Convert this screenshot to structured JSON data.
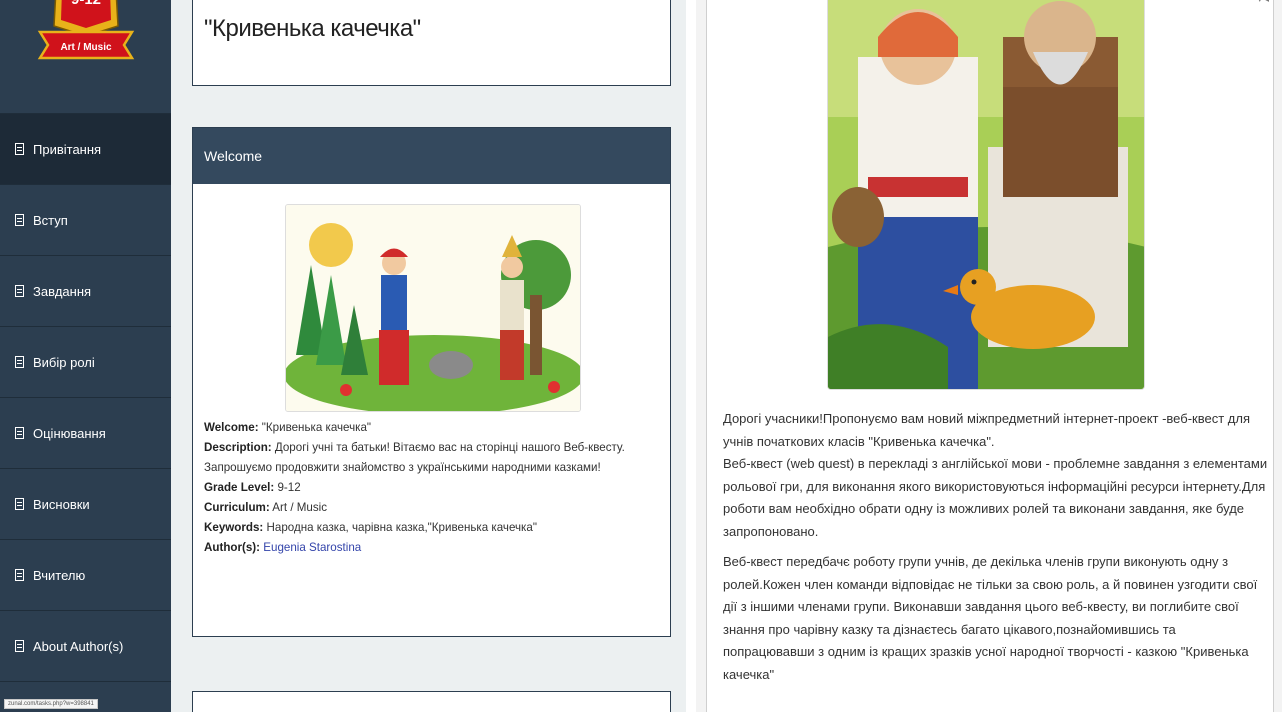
{
  "sidebar": {
    "badge": {
      "grade": "9-12",
      "subject": "Art / Music"
    },
    "items": [
      {
        "label": "Привітання",
        "active": true
      },
      {
        "label": "Вступ",
        "active": false
      },
      {
        "label": "Завдання",
        "active": false
      },
      {
        "label": "Вибір ролі",
        "active": false
      },
      {
        "label": "Оцінювання",
        "active": false
      },
      {
        "label": "Висновки",
        "active": false
      },
      {
        "label": "Вчителю",
        "active": false
      },
      {
        "label": "About Author(s)",
        "active": false
      }
    ]
  },
  "status_bar": {
    "url": "zunal.com/tasks.php?w=398841"
  },
  "page": {
    "title": "\"Кривенька качечка\""
  },
  "welcome_card": {
    "header": "Welcome",
    "welcome_label": "Welcome:",
    "welcome_value": " \"Кривенька качечка\"",
    "description_label": "Description:",
    "description_value": " Дорогі учні та батьки! Вітаємо вас на сторінці нашого Веб-квесту. Запрошуємо продовжити знайомство з українськими народними казками!",
    "grade_label": "Grade Level:",
    "grade_value": " 9-12",
    "curriculum_label": "Curriculum:",
    "curriculum_value": " Art / Music",
    "keywords_label": "Keywords:",
    "keywords_value": " Народна казка, чарівна казка,\"Кривенька качечка\"",
    "author_label": "Author(s):",
    "author_value": "Eugenia Starostina"
  },
  "right_pane": {
    "corner_text": "▾ ◂",
    "paragraph1": "Дорогі учасники!Пропонуємо вам новий міжпредметний інтернет-проект -веб-квест для учнів початкових класів \"Кривенька качечка\".",
    "paragraph2": "Веб-квест (web quest) в перекладі з англійської мови - проблемне завдання з елементами рольової гри, для виконання якого використовуються інформаційні ресурси інтернету.Для роботи вам необхідно обрати одну із можливих ролей та виконани  завдання, яке буде запропоновано.",
    "paragraph3": "Веб-квест передбачє роботу групи учнів, де декілька членів групи виконують одну з ролей.Кожен член команди відповідає не тільки за свою роль, а й повинен узгодити свої дії з іншими членами групи. Виконавши завдання цього веб-квесту, ви поглибите свої знання про чарівну казку та дізнаєтесь багато цікавого,познайомившись та попрацювавши з одним із кращих зразків усної народної творчості - казкою \"Кривенька качечка\""
  },
  "colors": {
    "sidebar_bg": "#2c3e50",
    "header_bg": "#34495e",
    "badge_red": "#d0121b",
    "badge_gold": "#e8b21a",
    "link": "#3344aa"
  }
}
